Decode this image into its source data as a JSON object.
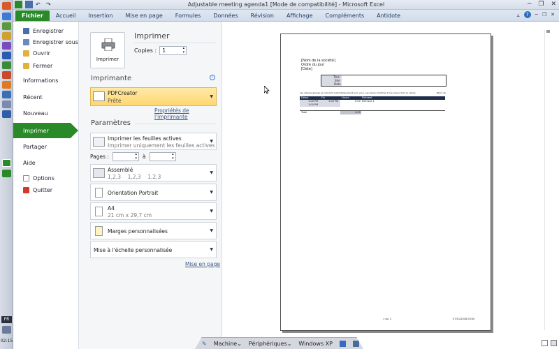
{
  "window": {
    "title": "Adjustable meeting agenda1  [Mode de compatibilité]  -  Microsoft Excel",
    "minimize": "─",
    "restore": "❐",
    "close": "✕"
  },
  "tabs": [
    "Fichier",
    "Accueil",
    "Insertion",
    "Mise en page",
    "Formules",
    "Données",
    "Révision",
    "Affichage",
    "Compléments",
    "Antidote"
  ],
  "nav": {
    "save": "Enregistrer",
    "save_as": "Enregistrer sous",
    "open": "Ouvrir",
    "close": "Fermer",
    "info": "Informations",
    "recent": "Récent",
    "new": "Nouveau",
    "print": "Imprimer",
    "share": "Partager",
    "help": "Aide",
    "options": "Options",
    "quit": "Quitter"
  },
  "print": {
    "heading": "Imprimer",
    "button_label": "Imprimer",
    "copies_label": "Copies :",
    "copies_value": "1",
    "printer_heading": "Imprimante",
    "printer_name": "PDFCreator",
    "printer_status": "Prête",
    "printer_props": "Propriétés de l'imprimante",
    "settings_heading": "Paramètres",
    "what_title": "Imprimer les feuilles actives",
    "what_sub": "Imprimer uniquement les feuilles actives",
    "pages_label": "Pages :",
    "pages_to": "à",
    "collate_title": "Assemblé",
    "collate_sub": "1,2,3    1,2,3    1,2,3",
    "orientation": "Orientation Portrait",
    "paper_title": "A4",
    "paper_sub": "21 cm x 29,7 cm",
    "margins": "Marges personnalisées",
    "scaling": "Mise à l'échelle personnalisée",
    "page_setup": "Mise en page"
  },
  "preview": {
    "company": "[Nom de la société]",
    "order": "Ordre du jour",
    "date": "[Date]",
    "fields": [
      "Titre",
      "Site",
      "Date"
    ],
    "note": "Les cellules grisées se calculent automatiquement pour vous. Les heures d'entrée d'une valeur dans la cellule",
    "note_right": "[Nom de",
    "table_headers": [
      "Début",
      "Fin",
      "Heure",
      "Élément"
    ],
    "row1": [
      "1:00 PM",
      "1:00 PM",
      "",
      "0:00",
      "Élément 1"
    ],
    "row2": [
      "1:00 PM"
    ],
    "total_label": "Total",
    "total_value": "0:00",
    "footer_left": "1 sur 2",
    "footer_right": "07/11/2018 00:00"
  },
  "vm": {
    "machine": "Machine",
    "devices": "Périphériques",
    "os": "Windows XP"
  },
  "system": {
    "lang": "FR",
    "time": "02:15"
  },
  "colors": {
    "accent_green": "#2a8a2a",
    "printer_highlight": "#ffd770",
    "link_blue": "#3b5a89"
  }
}
